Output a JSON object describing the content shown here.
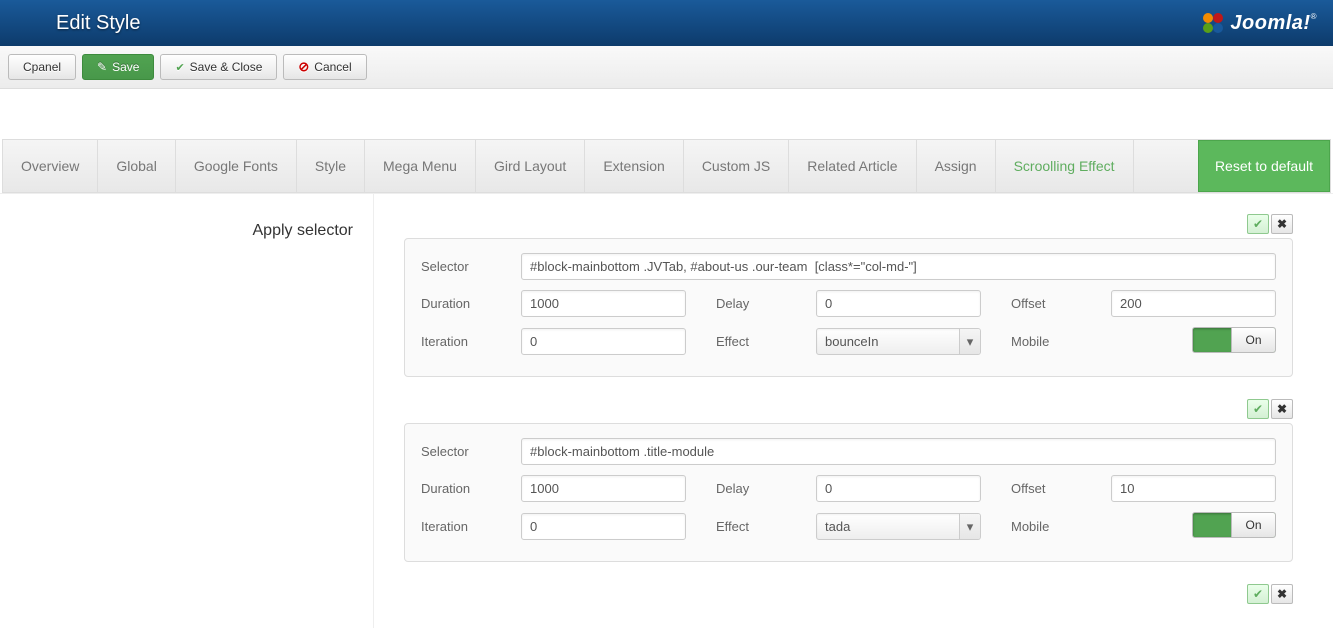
{
  "header": {
    "title": "Edit Style",
    "brand": "Joomla!"
  },
  "toolbar": {
    "cpanel": "Cpanel",
    "save": "Save",
    "save_close": "Save & Close",
    "cancel": "Cancel"
  },
  "tabs": {
    "items": [
      "Overview",
      "Global",
      "Google Fonts",
      "Style",
      "Mega Menu",
      "Gird Layout",
      "Extension",
      "Custom JS",
      "Related Article",
      "Assign",
      "Scroolling Effect"
    ],
    "reset": "Reset to default"
  },
  "left_label": "Apply selector",
  "labels": {
    "selector": "Selector",
    "duration": "Duration",
    "delay": "Delay",
    "offset": "Offset",
    "iteration": "Iteration",
    "effect": "Effect",
    "mobile": "Mobile",
    "toggle_on": "On"
  },
  "panels": [
    {
      "selector": "#block-mainbottom .JVTab, #about-us .our-team  [class*=\"col-md-\"]",
      "duration": "1000",
      "delay": "0",
      "offset": "200",
      "iteration": "0",
      "effect": "bounceIn"
    },
    {
      "selector": "#block-mainbottom .title-module",
      "duration": "1000",
      "delay": "0",
      "offset": "10",
      "iteration": "0",
      "effect": "tada"
    }
  ]
}
